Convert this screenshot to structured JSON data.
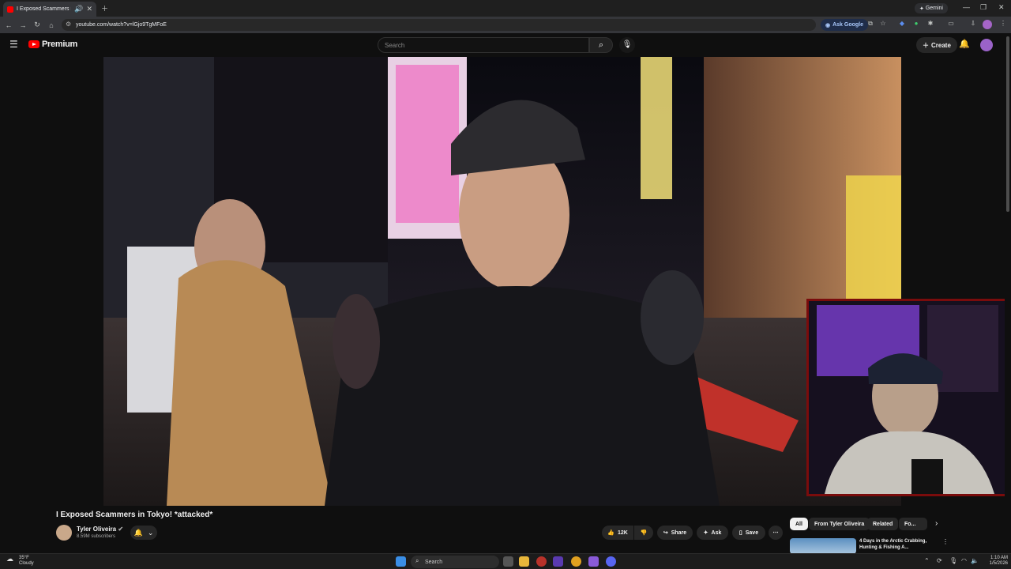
{
  "browser": {
    "tab_title": "I Exposed Scammers in Tok",
    "url": "youtube.com/watch?v=lGjo9TgMFoE",
    "ask_google": "Ask Google",
    "gemini": "Gemini"
  },
  "youtube": {
    "brand": "Premium",
    "search_placeholder": "Search",
    "create_label": "Create",
    "video_title": "I Exposed Scammers in Tokyo! *attacked*",
    "channel_name": "Tyler Oliveira",
    "subscribers": "8.59M subscribers",
    "likes": "12K",
    "share": "Share",
    "ask": "Ask",
    "save": "Save",
    "chips": [
      "All",
      "From Tyler Oliveira",
      "Related",
      "Fo..."
    ],
    "recommended_title": "4 Days in the Arctic Crabbing, Hunting & Fishing A..."
  },
  "taskbar": {
    "temp": "35°F",
    "condition": "Cloudy",
    "search": "Search",
    "time": "1:10 AM",
    "date": "1/5/2026"
  },
  "colors": {
    "youtube_red": "#ff0000",
    "webcam_border": "#7a0c0c",
    "background": "#0f0f0f"
  }
}
